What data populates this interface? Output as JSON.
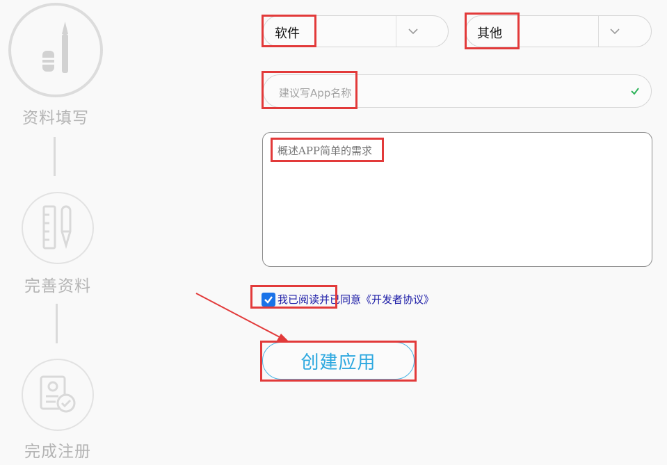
{
  "steps": [
    {
      "label": "资料填写",
      "icon": "pencil-eraser-icon",
      "active": true
    },
    {
      "label": "完善资料",
      "icon": "ruler-pen-icon",
      "active": false
    },
    {
      "label": "完成注册",
      "icon": "document-check-icon",
      "active": false
    }
  ],
  "form": {
    "category_select": {
      "value": "软件"
    },
    "subcategory_select": {
      "value": "其他"
    },
    "app_name_input": {
      "placeholder": "建议写App名称",
      "valid": true
    },
    "description_textarea": {
      "placeholder": "概述APP简单的需求"
    },
    "agreement": {
      "checked": true,
      "text": "我已阅读并已同意",
      "link_text": "《开发者协议》"
    },
    "submit_button": {
      "label": "创建应用"
    }
  },
  "colors": {
    "accent": "#2ba7df",
    "checkbox": "#1a73e8",
    "link": "#1a1aa6",
    "annotation": "#e23a3a",
    "valid": "#2eb35a"
  }
}
